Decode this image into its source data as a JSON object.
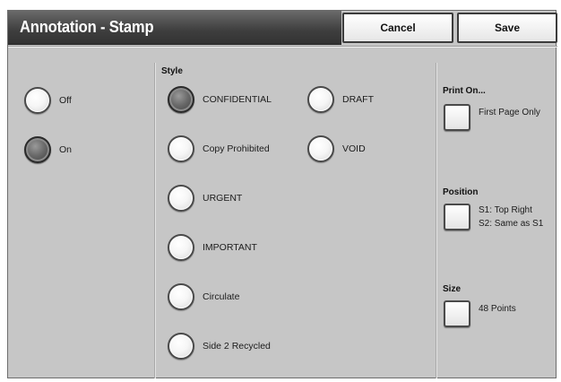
{
  "header": {
    "title": "Annotation - Stamp",
    "cancel_label": "Cancel",
    "save_label": "Save"
  },
  "onoff": {
    "options": [
      {
        "label": "Off",
        "selected": false
      },
      {
        "label": "On",
        "selected": true
      }
    ]
  },
  "style": {
    "heading": "Style",
    "options": [
      {
        "label": "CONFIDENTIAL",
        "selected": true
      },
      {
        "label": "Copy Prohibited",
        "selected": false
      },
      {
        "label": "URGENT",
        "selected": false
      },
      {
        "label": "IMPORTANT",
        "selected": false
      },
      {
        "label": "Circulate",
        "selected": false
      },
      {
        "label": "Side 2 Recycled",
        "selected": false
      },
      {
        "label": "DRAFT",
        "selected": false
      },
      {
        "label": "VOID",
        "selected": false
      }
    ]
  },
  "settings": {
    "print_on": {
      "heading": "Print On...",
      "value": "First Page Only"
    },
    "position": {
      "heading": "Position",
      "value_line1": "S1: Top Right",
      "value_line2": "S2: Same as S1"
    },
    "size": {
      "heading": "Size",
      "value": "48 Points"
    }
  }
}
